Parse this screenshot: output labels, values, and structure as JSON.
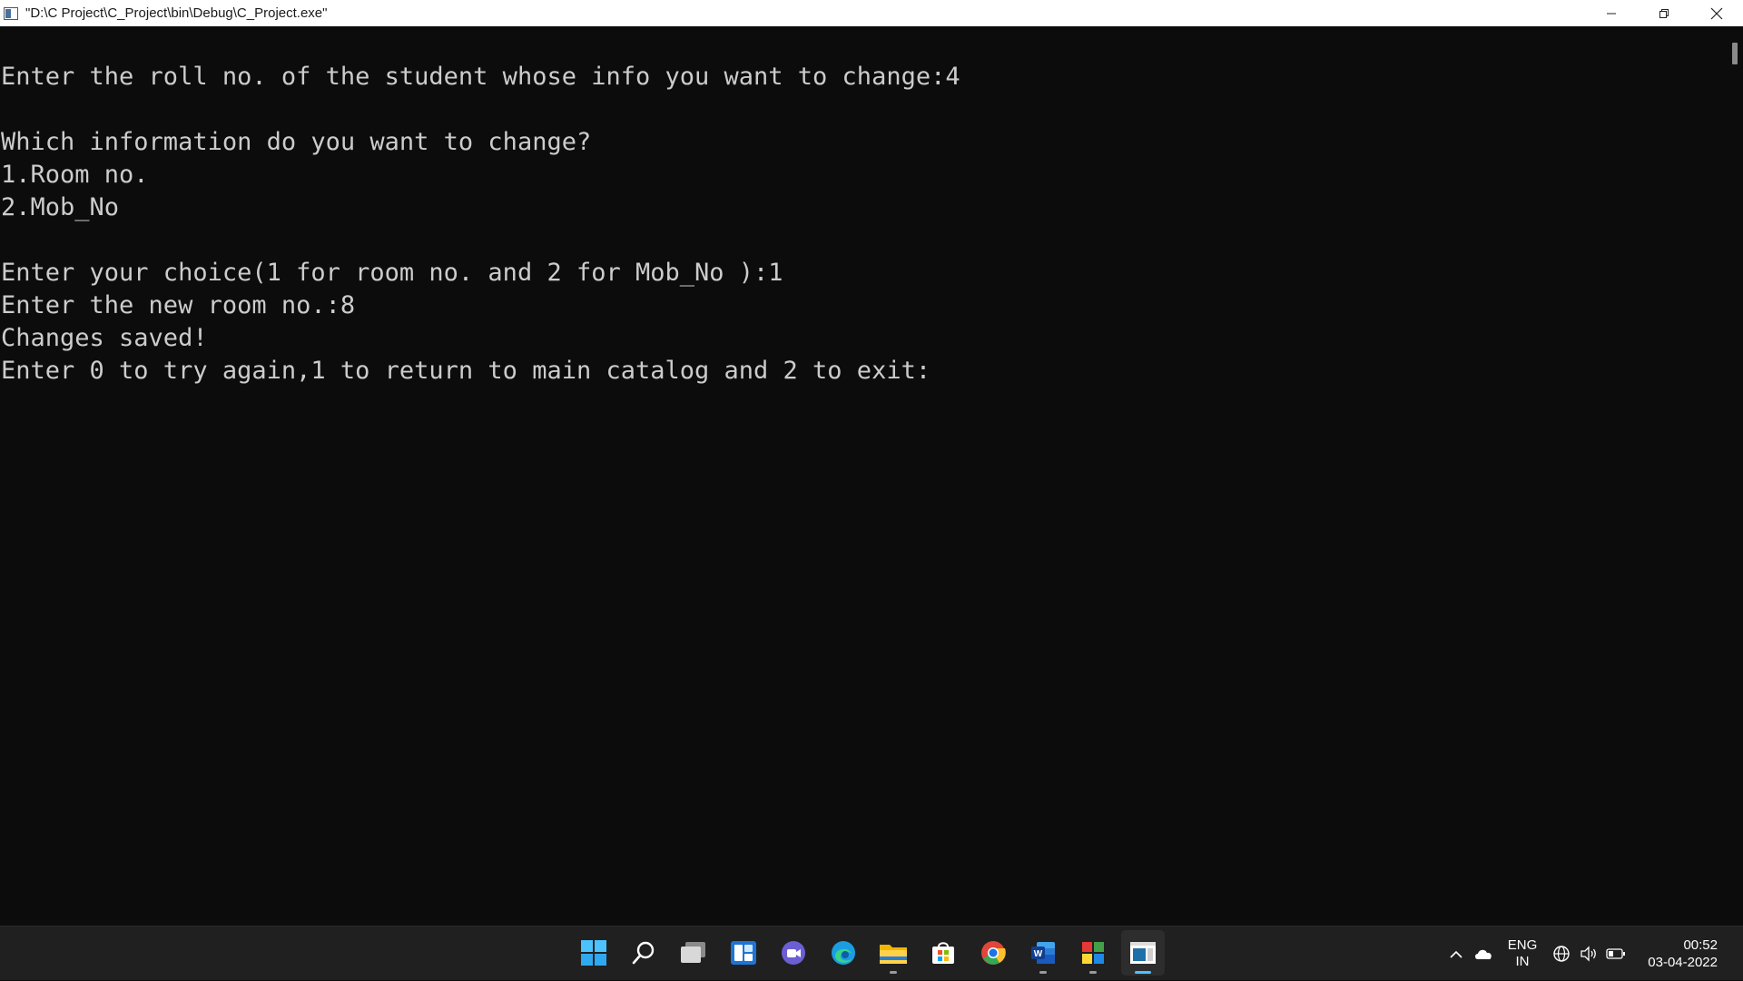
{
  "window": {
    "title": "\"D:\\C Project\\C_Project\\bin\\Debug\\C_Project.exe\""
  },
  "console": {
    "lines": [
      "Enter the roll no. of the student whose info you want to change:4",
      "",
      "Which information do you want to change?",
      "1.Room no.",
      "2.Mob_No",
      "",
      "Enter your choice(1 for room no. and 2 for Mob_No ):1",
      "Enter the new room no.:8",
      "Changes saved!",
      "Enter 0 to try again,1 to return to main catalog and 2 to exit:"
    ],
    "background": "#0c0c0c",
    "foreground": "#cccccc"
  },
  "taskbar": {
    "pinned": [
      {
        "name": "windows-start-icon"
      },
      {
        "name": "search-icon"
      },
      {
        "name": "task-view-icon"
      },
      {
        "name": "widgets-icon"
      },
      {
        "name": "chat-icon"
      },
      {
        "name": "edge-icon"
      },
      {
        "name": "file-explorer-icon"
      },
      {
        "name": "store-icon"
      },
      {
        "name": "chrome-icon"
      },
      {
        "name": "word-icon"
      },
      {
        "name": "codeblocks-icon"
      },
      {
        "name": "console-app-icon"
      }
    ],
    "language_line1": "ENG",
    "language_line2": "IN",
    "time": "00:52",
    "date": "03-04-2022",
    "accent": "#4cc2ff"
  }
}
